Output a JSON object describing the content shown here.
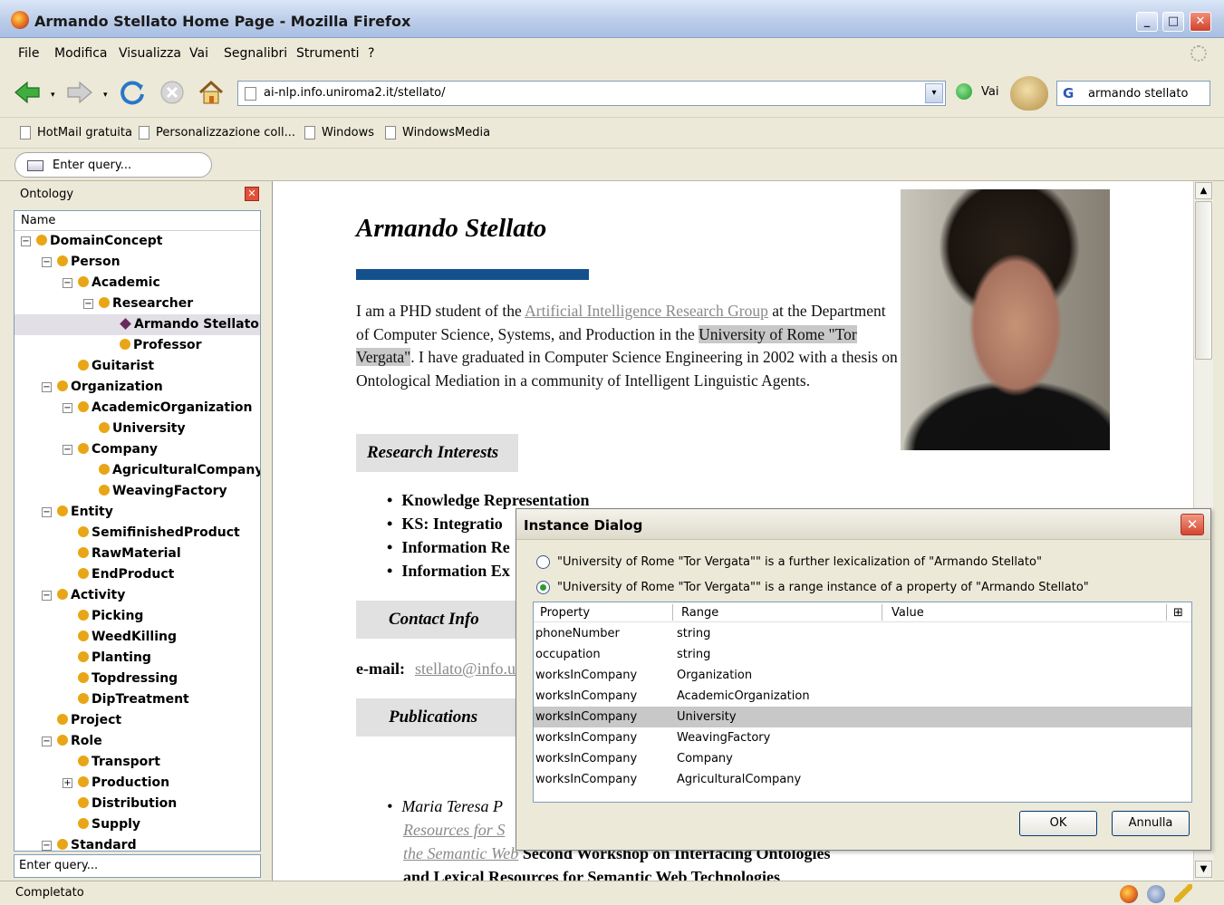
{
  "window": {
    "title": "Armando Stellato Home Page - Mozilla Firefox",
    "buttons": [
      "_",
      "□",
      "✕"
    ]
  },
  "menu": [
    "File",
    "Modifica",
    "Visualizza",
    "Vai",
    "Segnalibri",
    "Strumenti",
    "?"
  ],
  "navigation": {
    "url": "ai-nlp.info.uniroma2.it/stellato/",
    "go_label": "Vai",
    "search_value": "armando stellato",
    "search_engine_icon": "G",
    "dropdown_arrow": "▾"
  },
  "bookmarks": [
    "HotMail gratuita",
    "Personalizzazione coll...",
    "Windows",
    "WindowsMedia"
  ],
  "query_placeholder": "Enter query...",
  "ontology_panel": {
    "title": "Ontology",
    "close_icon": "✕",
    "column_header": "Name",
    "query_placeholder": "Enter query...",
    "nodes": [
      {
        "label": "DomainConcept",
        "expander": "−"
      },
      {
        "label": "Person",
        "expander": "−"
      },
      {
        "label": "Academic",
        "expander": "−"
      },
      {
        "label": "Researcher",
        "expander": "−"
      },
      {
        "label": "Armando Stellato",
        "expander": "",
        "instance": true,
        "selected": true
      },
      {
        "label": "Professor",
        "expander": ""
      },
      {
        "label": "Guitarist",
        "expander": ""
      },
      {
        "label": "Organization",
        "expander": "−"
      },
      {
        "label": "AcademicOrganization",
        "expander": "−"
      },
      {
        "label": "University",
        "expander": ""
      },
      {
        "label": "Company",
        "expander": "−"
      },
      {
        "label": "AgriculturalCompany",
        "expander": ""
      },
      {
        "label": "WeavingFactory",
        "expander": ""
      },
      {
        "label": "Entity",
        "expander": "−"
      },
      {
        "label": "SemifinishedProduct",
        "expander": ""
      },
      {
        "label": "RawMaterial",
        "expander": ""
      },
      {
        "label": "EndProduct",
        "expander": ""
      },
      {
        "label": "Activity",
        "expander": "−"
      },
      {
        "label": "Picking",
        "expander": ""
      },
      {
        "label": "WeedKilling",
        "expander": ""
      },
      {
        "label": "Planting",
        "expander": ""
      },
      {
        "label": "Topdressing",
        "expander": ""
      },
      {
        "label": "DipTreatment",
        "expander": ""
      },
      {
        "label": "Project",
        "expander": ""
      },
      {
        "label": "Role",
        "expander": "−"
      },
      {
        "label": "Transport",
        "expander": ""
      },
      {
        "label": "Production",
        "expander": "+"
      },
      {
        "label": "Distribution",
        "expander": ""
      },
      {
        "label": "Supply",
        "expander": ""
      },
      {
        "label": "Standard",
        "expander": "−"
      }
    ]
  },
  "page": {
    "heading": "Armando Stellato",
    "intro": {
      "t1": "I am a PHD student of the ",
      "link": "Artificial Intelligence Research Group",
      "t2": " at the Department of Computer Science, Systems, and Production in the ",
      "highlight": "University of Rome \"Tor Vergata\"",
      "t3": ". I have graduated in Computer Science Engineering in 2002 with a thesis on Ontological Mediation in a community of Intelligent Linguistic Agents."
    },
    "sections": [
      "Research Interests",
      "Contact Info",
      "Publications"
    ],
    "interests": [
      "Knowledge Representation",
      "KS: Integratio",
      "Information Re",
      "Information Ex"
    ],
    "email_label": "e-mail:",
    "email": "stellato@info.u",
    "publication": {
      "author": "Maria Teresa P",
      "line1": "Resources for S",
      "line2_link": "the Semantic Web",
      "line2_rest": " Second Workshop on Interfacing Ontologies",
      "line3": "and Lexical Resources for Semantic Web Technologies"
    }
  },
  "dialog": {
    "title": "Instance Dialog",
    "close_icon": "✕",
    "options": [
      {
        "text": "\"University of Rome \"Tor Vergata\"\" is a further lexicalization of \"Armando Stellato\"",
        "checked": false
      },
      {
        "text": "\"University of Rome \"Tor Vergata\"\" is a range instance of a property of \"Armando Stellato\"",
        "checked": true
      }
    ],
    "columns": [
      "Property",
      "Range",
      "Value"
    ],
    "column_menu_icon": "⊞",
    "rows": [
      {
        "property": "phoneNumber",
        "range": "string",
        "value": ""
      },
      {
        "property": "occupation",
        "range": "string",
        "value": ""
      },
      {
        "property": "worksInCompany",
        "range": "Organization",
        "value": ""
      },
      {
        "property": "worksInCompany",
        "range": "AcademicOrganization",
        "value": ""
      },
      {
        "property": "worksInCompany",
        "range": "University",
        "value": "",
        "selected": true
      },
      {
        "property": "worksInCompany",
        "range": "WeavingFactory",
        "value": ""
      },
      {
        "property": "worksInCompany",
        "range": "Company",
        "value": ""
      },
      {
        "property": "worksInCompany",
        "range": "AgriculturalCompany",
        "value": ""
      }
    ],
    "ok_label": "OK",
    "cancel_label": "Annulla"
  },
  "status": {
    "text": "Completato"
  },
  "colors": {
    "accent_bar": "#14508c",
    "tree_node_dot": "#e8a617",
    "selected_row": "#c8c8c8"
  }
}
